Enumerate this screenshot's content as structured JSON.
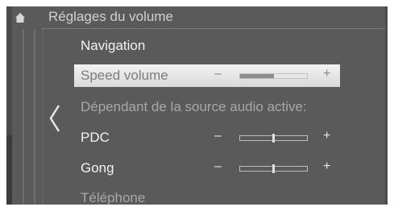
{
  "header": {
    "title": "Réglages du volume",
    "home_icon": "home-icon"
  },
  "nav": {
    "back_icon": "chevron-left-icon"
  },
  "rows": [
    {
      "label": "Navigation"
    },
    {
      "label": "Speed volume",
      "minus": "–",
      "plus": "+",
      "level": 0.5,
      "selected": true
    },
    {
      "label": "Dépendant de la source audio active:"
    },
    {
      "label": "PDC",
      "minus": "–",
      "plus": "+",
      "level": 0.5
    },
    {
      "label": "Gong",
      "minus": "–",
      "plus": "+",
      "level": 0.5
    },
    {
      "label": "Téléphone"
    }
  ],
  "colors": {
    "background": "#5a5a5a",
    "highlight": "#e6e6e6",
    "text": "#f2f2f2",
    "dim_text": "#a8a8a8"
  }
}
